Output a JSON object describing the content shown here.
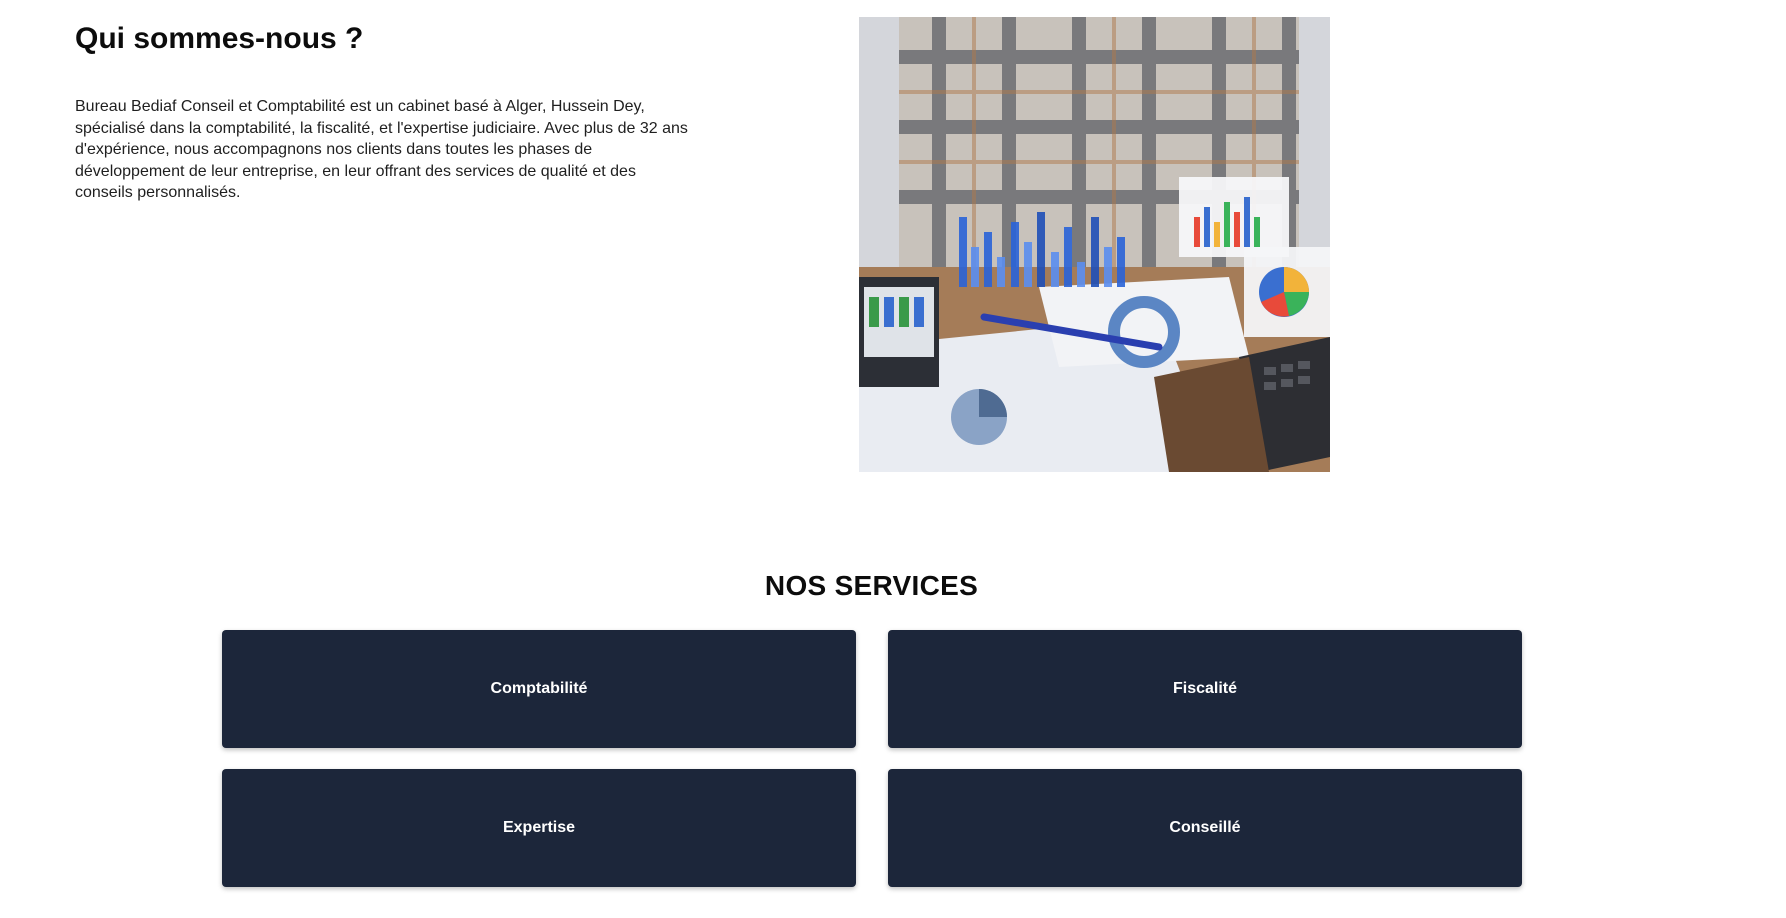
{
  "about": {
    "title": "Qui sommes-nous ?",
    "text": "Bureau Bediaf Conseil et Comptabilité est un cabinet basé à Alger, Hussein Dey, spécialisé dans la comptabilité, la fiscalité, et l'expertise judiciaire. Avec plus de 32 ans d'expérience, nous accompagnons nos clients dans toutes les phases de développement de leur entreprise, en leur offrant des services de qualité et des conseils personnalisés."
  },
  "services": {
    "title": "NOS SERVICES",
    "items": [
      {
        "label": "Comptabilité"
      },
      {
        "label": "Fiscalité"
      },
      {
        "label": "Expertise"
      },
      {
        "label": "Conseillé"
      }
    ]
  },
  "colors": {
    "card_bg": "#1c263a",
    "card_text": "#ffffff",
    "heading": "#0c0c0c"
  }
}
